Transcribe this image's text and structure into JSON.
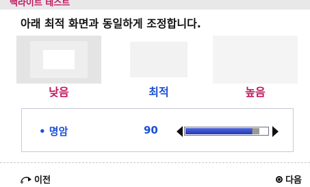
{
  "header": {
    "title": "백라이트 테스트"
  },
  "instruction": "아래 최적 화면과 동일하게 조정합니다.",
  "previews": [
    {
      "label": "낮음"
    },
    {
      "label": "최적"
    },
    {
      "label": "높음"
    }
  ],
  "control": {
    "name": "• 명암",
    "value": "90",
    "level_fraction": 0.9
  },
  "footer": {
    "prev_label": "이전",
    "next_label": "다음"
  },
  "colors": {
    "accent_red": "#c0175f",
    "accent_blue": "#1a4fd6"
  }
}
